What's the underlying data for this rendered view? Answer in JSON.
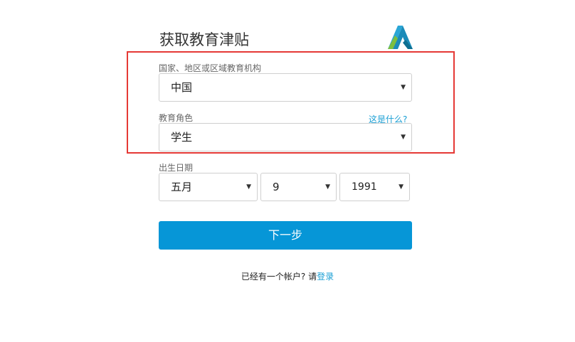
{
  "page": {
    "title": "获取教育津贴"
  },
  "form": {
    "country": {
      "label": "国家、地区或区域教育机构",
      "value": "中国"
    },
    "role": {
      "label": "教育角色",
      "help": "这是什么?",
      "value": "学生"
    },
    "birthdate": {
      "label": "出生日期",
      "month": "五月",
      "day": "9",
      "year": "1991"
    },
    "next_button": "下一步"
  },
  "footer": {
    "text": "已经有一个帐户? 请",
    "login_link": "登录"
  },
  "colors": {
    "primary": "#0696d7",
    "highlight": "#e53935"
  }
}
